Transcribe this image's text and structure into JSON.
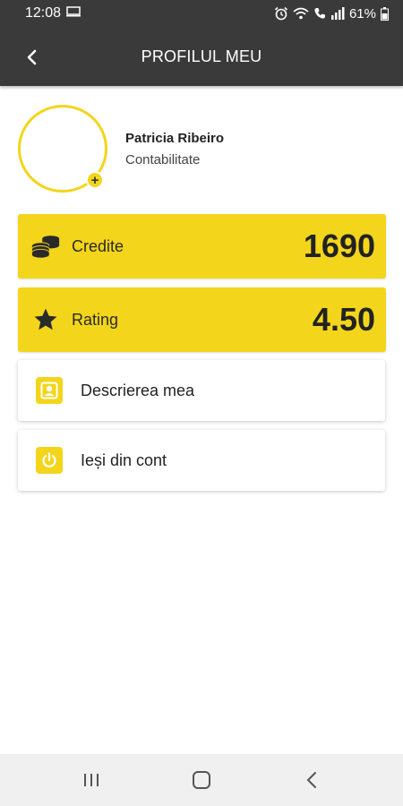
{
  "status": {
    "time": "12:08",
    "battery": "61%"
  },
  "header": {
    "title": "PROFILUL MEU"
  },
  "profile": {
    "name": "Patricia Ribeiro",
    "department": "Contabilitate",
    "add_symbol": "+"
  },
  "stats": [
    {
      "label": "Credite",
      "value": "1690",
      "icon": "coins-icon"
    },
    {
      "label": "Rating",
      "value": "4.50",
      "icon": "star-icon"
    }
  ],
  "menu": [
    {
      "label": "Descrierea mea",
      "icon": "person-icon"
    },
    {
      "label": "Ieși din cont",
      "icon": "power-icon"
    }
  ],
  "colors": {
    "accent": "#f3d51b",
    "bar": "#3a3a3a"
  }
}
